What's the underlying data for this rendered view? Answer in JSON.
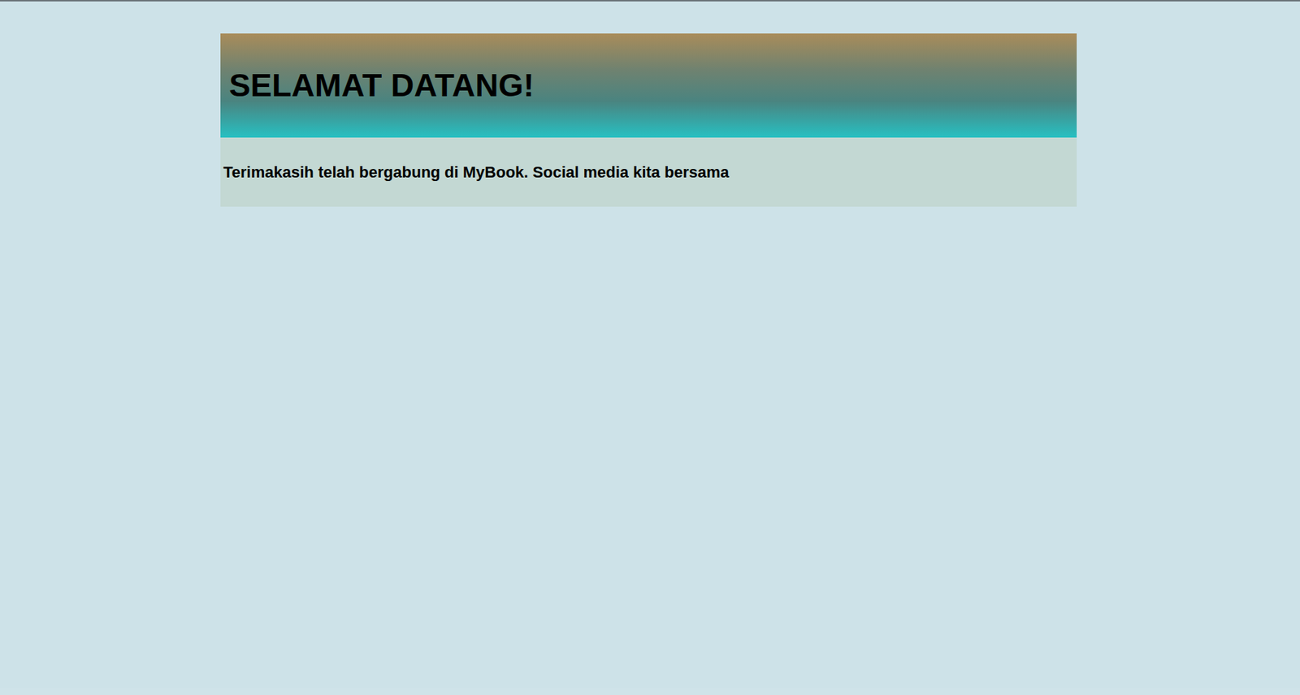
{
  "header": {
    "title": "SELAMAT DATANG!"
  },
  "message": {
    "text": "Terimakasih telah bergabung di MyBook. Social media kita bersama"
  }
}
